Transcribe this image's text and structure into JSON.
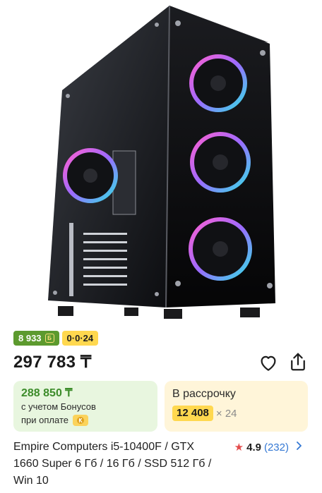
{
  "product": {
    "title": "Empire Computers i5-10400F / GTX 1660 Super 6 Гб / 16 Гб / SSD 512 Гб / Win 10",
    "price": "297 783 ₸",
    "bonus_badge": "8 933",
    "installment_badge": "0·0·24",
    "bonus_card": {
      "price": "288 850 ₸",
      "line1": "с учетом Бонусов",
      "line2": "при оплате"
    },
    "installment_card": {
      "title": "В рассрочку",
      "amount": "12 408",
      "months": "× 24"
    },
    "rating": {
      "value": "4.9",
      "reviews": "(232)"
    }
  },
  "icons": {
    "heart": "heart-icon",
    "share": "share-icon",
    "star": "star-icon",
    "chevron": "chevron-right-icon",
    "kaspi": "kaspi-logo-icon"
  },
  "colors": {
    "bonus_green": "#5c9a2e",
    "installment_yellow": "#ffd84f",
    "link_blue": "#3478d4",
    "star_red": "#e34b4b"
  }
}
